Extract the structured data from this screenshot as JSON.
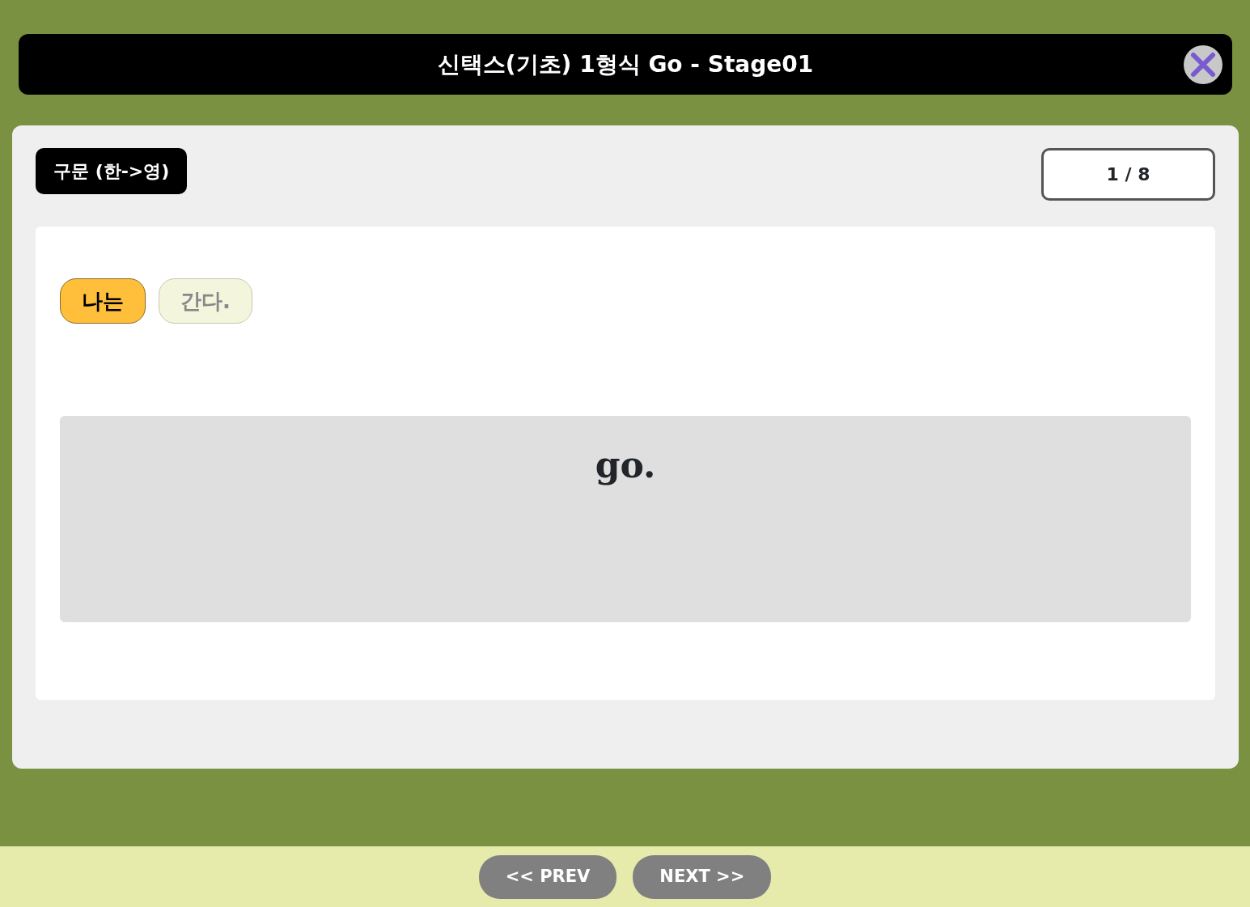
{
  "header": {
    "title": "신택스(기초) 1형식 Go - Stage01"
  },
  "mode_label": "구문 (한->영)",
  "counter": "1 / 8",
  "words": [
    {
      "text": "나는",
      "selected": true
    },
    {
      "text": "간다.",
      "selected": false
    }
  ],
  "answer": "go.",
  "buttons": [
    {
      "label": "<< PREV"
    },
    {
      "label": "NEXT >>"
    }
  ]
}
